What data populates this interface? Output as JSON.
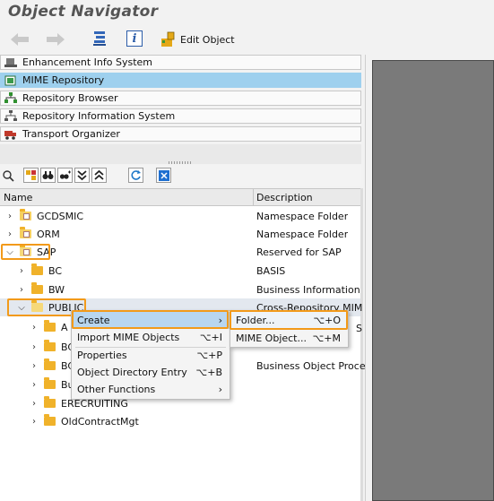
{
  "title": "Object Navigator",
  "toolbar": {
    "edit_object": "Edit Object"
  },
  "nav_list": [
    {
      "label": "Enhancement Info System",
      "icon": "enhancement-icon"
    },
    {
      "label": "MIME Repository",
      "icon": "mime-icon",
      "selected": true
    },
    {
      "label": "Repository Browser",
      "icon": "repository-browser-icon"
    },
    {
      "label": "Repository Information System",
      "icon": "repository-info-icon"
    },
    {
      "label": "Transport Organizer",
      "icon": "transport-icon"
    }
  ],
  "columns": {
    "name": "Name",
    "description": "Description"
  },
  "tree": [
    {
      "name": "GCDSMIC",
      "desc": "Namespace Folder"
    },
    {
      "name": "ORM",
      "desc": "Namespace Folder"
    },
    {
      "name": "SAP",
      "desc": "Reserved for SAP"
    },
    {
      "name": "BC",
      "desc": "BASIS"
    },
    {
      "name": "BW",
      "desc": "Business Information"
    },
    {
      "name": "PUBLIC",
      "desc": "Cross-Repository MIM"
    },
    {
      "name": "A",
      "desc": ""
    },
    {
      "name": "BC",
      "desc": ""
    },
    {
      "name": "BC",
      "desc": "Business Object Proce"
    },
    {
      "name": "Bu",
      "desc": ""
    },
    {
      "name": "ERECRUITING",
      "desc": ""
    },
    {
      "name": "OldContractMgt",
      "desc": ""
    }
  ],
  "context_menu": [
    {
      "label": "Create",
      "shortcut": ""
    },
    {
      "label": "Import MIME Objects",
      "shortcut": "⌥+I"
    },
    {
      "label": "Properties",
      "shortcut": "⌥+P"
    },
    {
      "label": "Object Directory Entry",
      "shortcut": "⌥+B"
    },
    {
      "label": "Other Functions",
      "shortcut": ""
    }
  ],
  "submenu": [
    {
      "label": "Folder...",
      "shortcut": "⌥+O"
    },
    {
      "label": "MIME Object...",
      "shortcut": "⌥+M"
    }
  ],
  "partial_text": "S",
  "colors": {
    "selected": "#9ed0ee",
    "highlight": "#f29a1a",
    "right_panel": "#7a7a7a"
  }
}
